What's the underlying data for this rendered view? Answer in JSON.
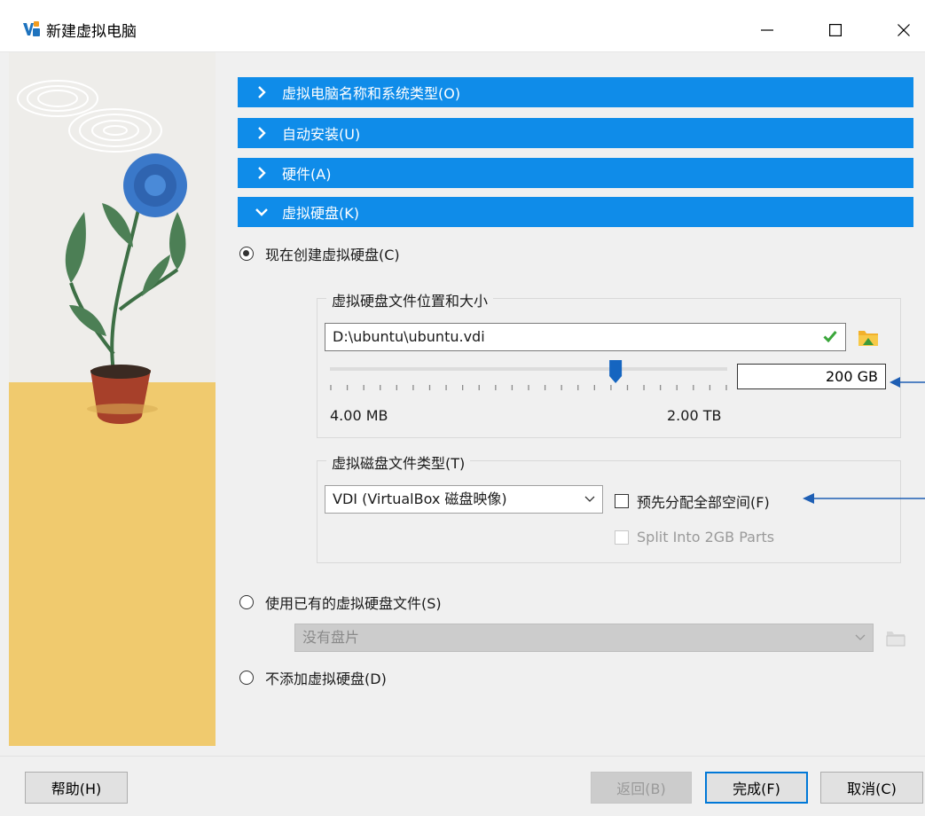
{
  "window": {
    "title": "新建虚拟电脑",
    "controls": {
      "minimize": "minimize",
      "maximize": "maximize",
      "close": "close"
    }
  },
  "sections": [
    {
      "label": "虚拟电脑名称和系统类型(O)",
      "expanded": false
    },
    {
      "label": "自动安装(U)",
      "expanded": false
    },
    {
      "label": "硬件(A)",
      "expanded": false
    },
    {
      "label": "虚拟硬盘(K)",
      "expanded": true
    }
  ],
  "disk_options": {
    "create_now": {
      "label": "现在创建虚拟硬盘(C)",
      "selected": true
    },
    "use_existing": {
      "label": "使用已有的虚拟硬盘文件(S)",
      "selected": false
    },
    "no_disk": {
      "label": "不添加虚拟硬盘(D)",
      "selected": false
    }
  },
  "location_group": {
    "title": "虚拟硬盘文件位置和大小",
    "path": "D:\\ubuntu\\ubuntu.vdi",
    "size": "200 GB",
    "slider_min_label": "4.00 MB",
    "slider_max_label": "2.00 TB",
    "slider_fraction": 0.72
  },
  "type_group": {
    "title": "虚拟磁盘文件类型(T)",
    "type_selected": "VDI (VirtualBox 磁盘映像)",
    "preallocate_label": "预先分配全部空间(F)",
    "preallocate_checked": false,
    "split_label": "Split Into 2GB Parts",
    "split_checked": false,
    "split_enabled": false
  },
  "existing_disk": {
    "selected": "没有盘片"
  },
  "buttons": {
    "help": "帮助(H)",
    "back": "返回(B)",
    "finish": "完成(F)",
    "cancel": "取消(C)"
  },
  "colors": {
    "section_header": "#0f8ce9",
    "annotation_arrow": "#1f5fb4",
    "illustration_yellow": "#f0ca6e"
  },
  "icons": {
    "section_collapsed": "chevron-right-icon",
    "section_expanded": "chevron-down-icon",
    "path_valid": "checkmark-icon",
    "browse": "folder-icon"
  }
}
